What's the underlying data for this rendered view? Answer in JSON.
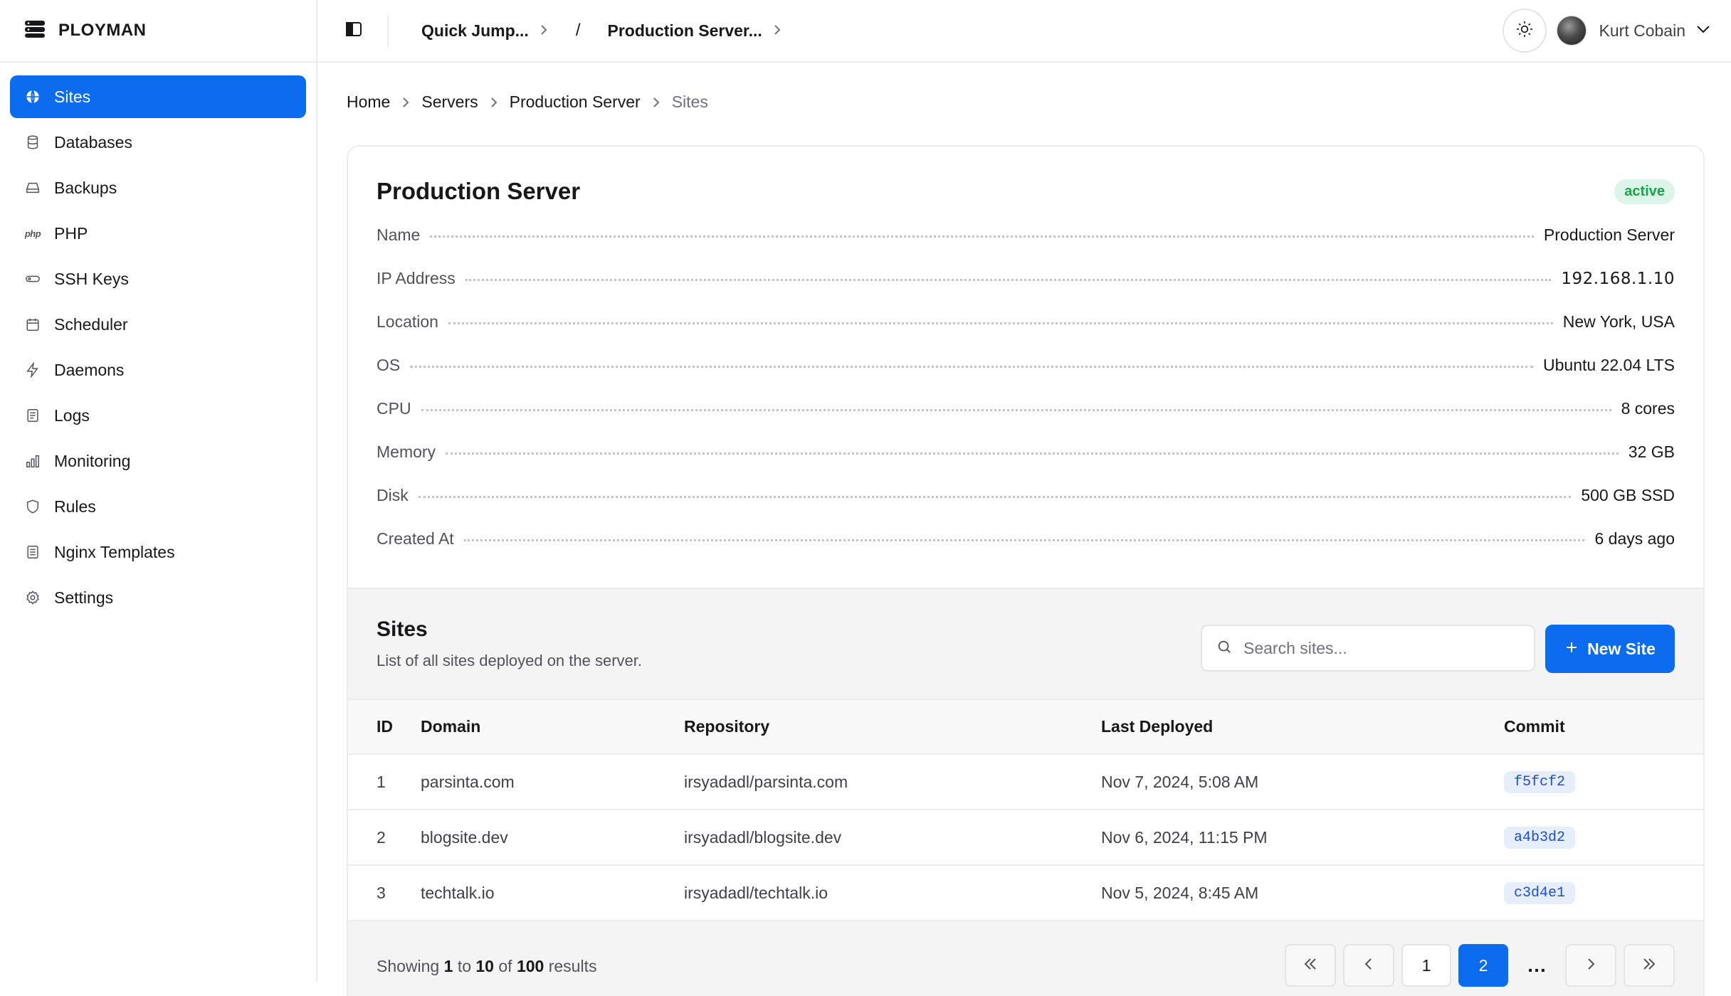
{
  "app": {
    "brand": "PLOYMAN"
  },
  "sidebar": {
    "items": [
      {
        "label": "Sites",
        "icon": "globe-icon",
        "active": true
      },
      {
        "label": "Databases",
        "icon": "database-icon"
      },
      {
        "label": "Backups",
        "icon": "hard-drive-icon"
      },
      {
        "label": "PHP",
        "icon": "php-icon"
      },
      {
        "label": "SSH Keys",
        "icon": "key-icon"
      },
      {
        "label": "Scheduler",
        "icon": "calendar-icon"
      },
      {
        "label": "Daemons",
        "icon": "lightning-icon"
      },
      {
        "label": "Logs",
        "icon": "file-text-icon"
      },
      {
        "label": "Monitoring",
        "icon": "bar-chart-icon"
      },
      {
        "label": "Rules",
        "icon": "shield-icon"
      },
      {
        "label": "Nginx Templates",
        "icon": "file-list-icon"
      },
      {
        "label": "Settings",
        "icon": "gear-icon"
      }
    ]
  },
  "topbar": {
    "quick_jump": "Quick Jump...",
    "separator": "/",
    "server_switch": "Production Server...",
    "user_name": "Kurt Cobain"
  },
  "breadcrumb": [
    "Home",
    "Servers",
    "Production Server",
    "Sites"
  ],
  "server": {
    "title": "Production Server",
    "status": "active",
    "details": [
      {
        "key": "Name",
        "value": "Production Server"
      },
      {
        "key": "IP Address",
        "value": "192.168.1.10"
      },
      {
        "key": "Location",
        "value": "New York, USA"
      },
      {
        "key": "OS",
        "value": "Ubuntu 22.04 LTS"
      },
      {
        "key": "CPU",
        "value": "8 cores"
      },
      {
        "key": "Memory",
        "value": "32 GB"
      },
      {
        "key": "Disk",
        "value": "500 GB SSD"
      },
      {
        "key": "Created At",
        "value": "6 days ago"
      }
    ]
  },
  "sites": {
    "title": "Sites",
    "description": "List of all sites deployed on the server.",
    "search_placeholder": "Search sites...",
    "new_button": "New Site",
    "columns": [
      "ID",
      "Domain",
      "Repository",
      "Last Deployed",
      "Commit"
    ],
    "rows": [
      {
        "id": "1",
        "domain": "parsinta.com",
        "repository": "irsyadadl/parsinta.com",
        "last_deployed": "Nov 7, 2024, 5:08 AM",
        "commit": "f5fcf2"
      },
      {
        "id": "2",
        "domain": "blogsite.dev",
        "repository": "irsyadadl/blogsite.dev",
        "last_deployed": "Nov 6, 2024, 11:15 PM",
        "commit": "a4b3d2"
      },
      {
        "id": "3",
        "domain": "techtalk.io",
        "repository": "irsyadadl/techtalk.io",
        "last_deployed": "Nov 5, 2024, 8:45 AM",
        "commit": "c3d4e1"
      }
    ]
  },
  "pagination": {
    "showing_prefix": "Showing",
    "from": "1",
    "to_word": "to",
    "to": "10",
    "of_word": "of",
    "total": "100",
    "results_word": "results",
    "pages": [
      "1",
      "2"
    ],
    "current_page": "2",
    "ellipsis": "…"
  },
  "colors": {
    "accent": "#0b6cf0",
    "status_green": "#16a34a",
    "commit_blue": "#1d4ed8"
  }
}
